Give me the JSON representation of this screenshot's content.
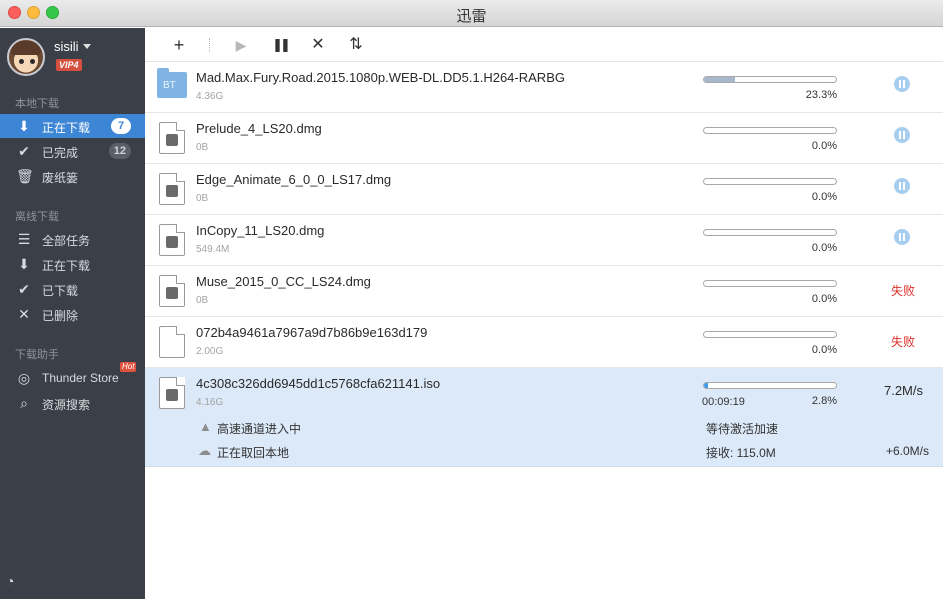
{
  "window": {
    "title": "迅雷"
  },
  "user": {
    "name": "sisili",
    "vip": "VIP4"
  },
  "sidebar": {
    "sections": [
      {
        "title": "本地下载"
      },
      {
        "title": "离线下载"
      },
      {
        "title": "下载助手"
      }
    ],
    "local": [
      {
        "label": "正在下载",
        "badge": "7",
        "icon": "download-arrow-icon",
        "active": true
      },
      {
        "label": "已完成",
        "badge": "12",
        "icon": "check-icon"
      },
      {
        "label": "废纸篓",
        "icon": "trash-icon"
      }
    ],
    "offline": [
      {
        "label": "全部任务",
        "icon": "list-icon"
      },
      {
        "label": "正在下载",
        "icon": "download-arrow-icon"
      },
      {
        "label": "已下载",
        "icon": "check-icon"
      },
      {
        "label": "已删除",
        "icon": "x-icon"
      }
    ],
    "helper": [
      {
        "label": "Thunder Store",
        "hot": "Hot",
        "icon": "compass-icon"
      },
      {
        "label": "资源搜索",
        "icon": "search-icon"
      }
    ]
  },
  "toolbar": {
    "buttons": [
      {
        "icon": "plus-icon",
        "glyph": "+"
      },
      {
        "icon": "play-icon",
        "glyph": "▶"
      },
      {
        "icon": "pause-icon",
        "glyph": "❚❚"
      },
      {
        "icon": "delete-icon",
        "glyph": "✕"
      },
      {
        "icon": "sort-icon",
        "glyph": "⇅"
      }
    ]
  },
  "downloads": [
    {
      "name": "Mad.Max.Fury.Road.2015.1080p.WEB-DL.DD5.1.H264-RARBG",
      "size": "4.36G",
      "progress": 23.3,
      "percent": "23.3%",
      "status": "paused",
      "type": "bt",
      "type_label": "BT"
    },
    {
      "name": "Prelude_4_LS20.dmg",
      "size": "0B",
      "progress": 0,
      "percent": "0.0%",
      "status": "paused",
      "type": "dmg"
    },
    {
      "name": "Edge_Animate_6_0_0_LS17.dmg",
      "size": "0B",
      "progress": 0,
      "percent": "0.0%",
      "status": "paused",
      "type": "dmg"
    },
    {
      "name": "InCopy_11_LS20.dmg",
      "size": "549.4M",
      "progress": 0,
      "percent": "0.0%",
      "status": "paused",
      "type": "dmg"
    },
    {
      "name": "Muse_2015_0_CC_LS24.dmg",
      "size": "0B",
      "progress": 0,
      "percent": "0.0%",
      "status": "failed",
      "status_text": "失败",
      "type": "dmg"
    },
    {
      "name": "072b4a9461a7967a9d7b86b9e163d179",
      "size": "2.00G",
      "progress": 0,
      "percent": "0.0%",
      "status": "failed",
      "status_text": "失败",
      "type": "blank"
    },
    {
      "name": "4c308c326dd6945dd1c5768cfa621141.iso",
      "size": "4.16G",
      "progress": 2.8,
      "percent": "2.8%",
      "status": "downloading",
      "eta": "00:09:19",
      "speed": "7.2M/s",
      "type": "iso",
      "details": {
        "channel": "高速通道进入中",
        "channel_status": "等待激活加速",
        "fetch": "正在取回本地",
        "received": "接收: 115.0M",
        "extra_speed": "+6.0M/s"
      }
    }
  ],
  "colors": {
    "accent": "#3d86d6",
    "sidebar_bg": "#3b4048",
    "selected_row": "#dbe9f8",
    "fail": "#e0322b"
  }
}
